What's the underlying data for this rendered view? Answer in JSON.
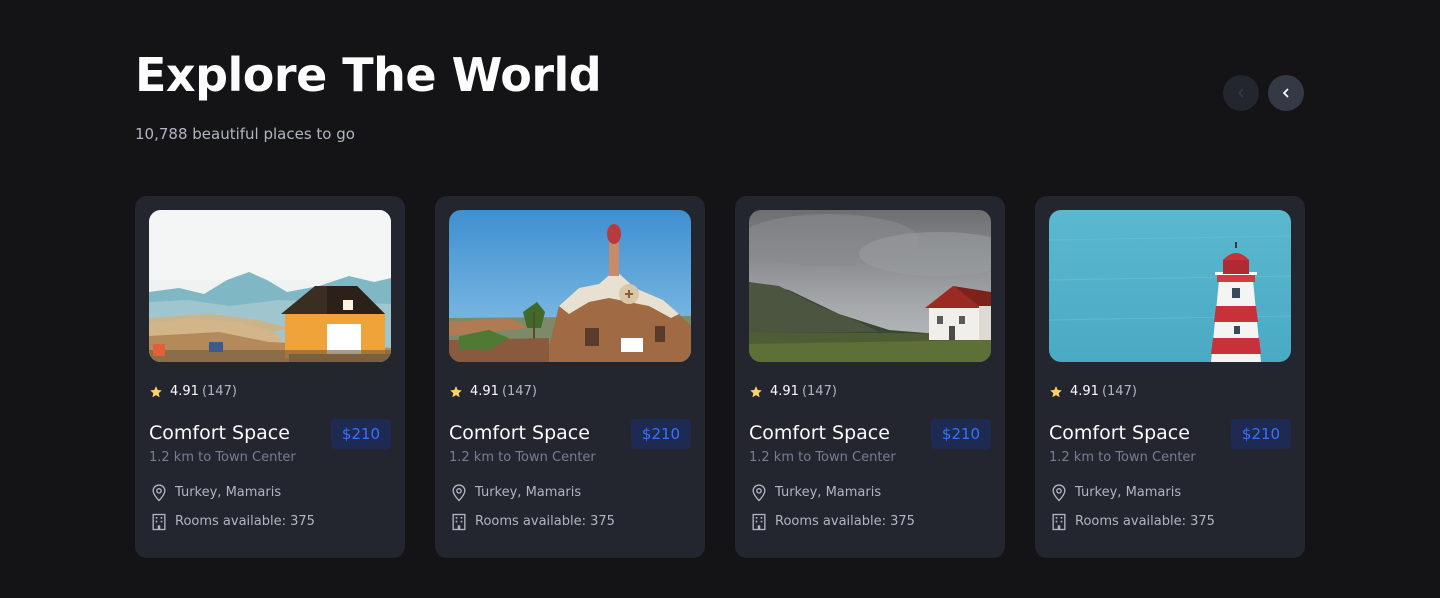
{
  "header": {
    "title": "Explore The World",
    "subtitle": "10,788 beautiful places to go"
  },
  "nav": {
    "prev_icon": "chevron-left-icon",
    "next_icon": "chevron-left-icon"
  },
  "cards": [
    {
      "photo": "house-landscape-photo",
      "rating": "4.91",
      "reviews": "(147)",
      "name": "Comfort Space",
      "price": "$210",
      "distance": "1.2 km to Town Center",
      "location": "Turkey, Mamaris",
      "rooms": "Rooms available: 375"
    },
    {
      "photo": "mosaic-building-photo",
      "rating": "4.91",
      "reviews": "(147)",
      "name": "Comfort Space",
      "price": "$210",
      "distance": "1.2 km to Town Center",
      "location": "Turkey, Mamaris",
      "rooms": "Rooms available: 375"
    },
    {
      "photo": "coastal-house-photo",
      "rating": "4.91",
      "reviews": "(147)",
      "name": "Comfort Space",
      "price": "$210",
      "distance": "1.2 km to Town Center",
      "location": "Turkey, Mamaris",
      "rooms": "Rooms available: 375"
    },
    {
      "photo": "lighthouse-sea-photo",
      "rating": "4.91",
      "reviews": "(147)",
      "name": "Comfort Space",
      "price": "$210",
      "distance": "1.2 km to Town Center",
      "location": "Turkey, Mamaris",
      "rooms": "Rooms available: 375"
    }
  ],
  "colors": {
    "background": "#141416",
    "card": "#23262f",
    "accent": "#3772ff",
    "star": "#ffd166",
    "muted": "#777e90"
  }
}
